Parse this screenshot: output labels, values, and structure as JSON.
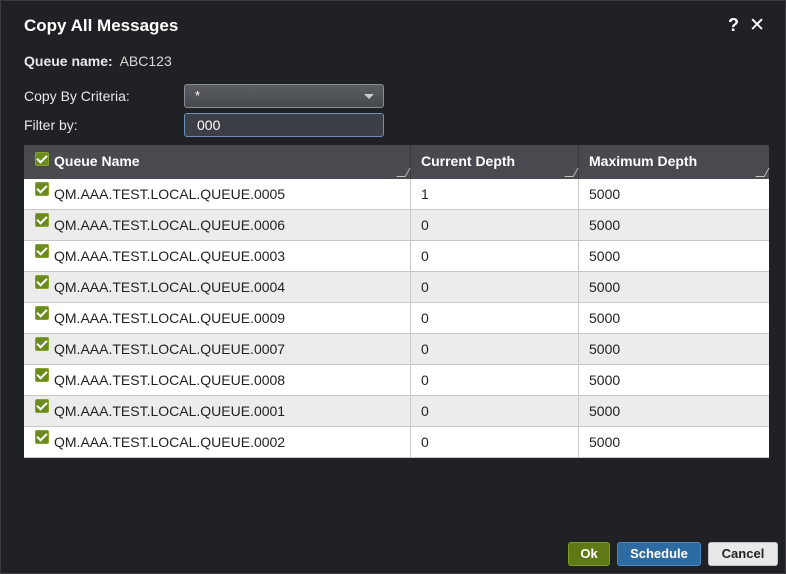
{
  "dialog": {
    "title": "Copy All Messages",
    "help_glyph": "?",
    "close_glyph": "✕"
  },
  "queue": {
    "label": "Queue name:",
    "value": "ABC123"
  },
  "criteria": {
    "label": "Copy By Criteria:",
    "value": "*"
  },
  "filter": {
    "label": "Filter by:",
    "value": "000"
  },
  "grid": {
    "columns": [
      "Queue Name",
      "Current Depth",
      "Maximum Depth"
    ],
    "header_checked": true,
    "rows": [
      {
        "name": "QM.AAA.TEST.LOCAL.QUEUE.0005",
        "current": "1",
        "max": "5000",
        "checked": true
      },
      {
        "name": "QM.AAA.TEST.LOCAL.QUEUE.0006",
        "current": "0",
        "max": "5000",
        "checked": true
      },
      {
        "name": "QM.AAA.TEST.LOCAL.QUEUE.0003",
        "current": "0",
        "max": "5000",
        "checked": true
      },
      {
        "name": "QM.AAA.TEST.LOCAL.QUEUE.0004",
        "current": "0",
        "max": "5000",
        "checked": true
      },
      {
        "name": "QM.AAA.TEST.LOCAL.QUEUE.0009",
        "current": "0",
        "max": "5000",
        "checked": true
      },
      {
        "name": "QM.AAA.TEST.LOCAL.QUEUE.0007",
        "current": "0",
        "max": "5000",
        "checked": true
      },
      {
        "name": "QM.AAA.TEST.LOCAL.QUEUE.0008",
        "current": "0",
        "max": "5000",
        "checked": true
      },
      {
        "name": "QM.AAA.TEST.LOCAL.QUEUE.0001",
        "current": "0",
        "max": "5000",
        "checked": true
      },
      {
        "name": "QM.AAA.TEST.LOCAL.QUEUE.0002",
        "current": "0",
        "max": "5000",
        "checked": true
      }
    ]
  },
  "buttons": {
    "ok": "Ok",
    "schedule": "Schedule",
    "cancel": "Cancel"
  },
  "colors": {
    "ok": "#5f7a14",
    "schedule": "#2d6ba3",
    "checkbox": "#6b8a1f",
    "background": "#202124"
  }
}
